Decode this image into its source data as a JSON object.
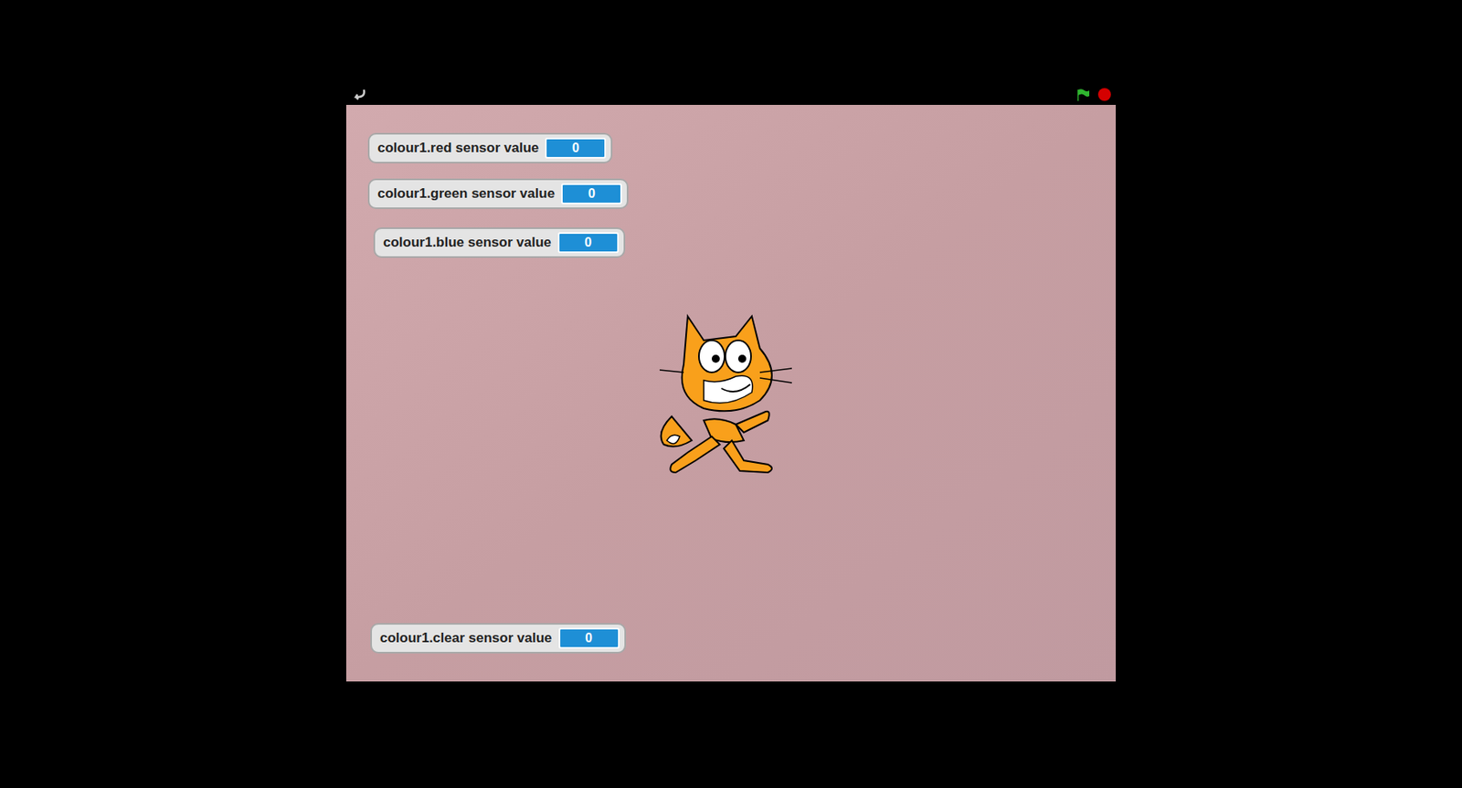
{
  "stage": {
    "monitors": [
      {
        "label": "colour1.red sensor value",
        "value": "0"
      },
      {
        "label": "colour1.green sensor value",
        "value": "0"
      },
      {
        "label": "colour1.blue sensor value",
        "value": "0"
      },
      {
        "label": "colour1.clear sensor value",
        "value": "0"
      }
    ]
  }
}
